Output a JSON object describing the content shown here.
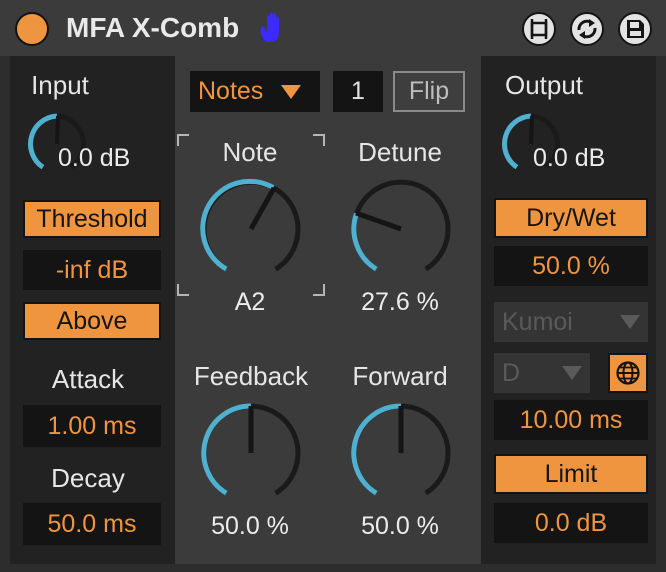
{
  "device": {
    "title": "MFA X-Comb",
    "hand_icon_color": "#3b2bff",
    "accent": "#f0953f",
    "knob_arc_color": "#4fb0d0"
  },
  "input": {
    "label": "Input",
    "value": "0.0 dB",
    "threshold_label": "Threshold",
    "threshold_value": "-inf dB",
    "mode_label": "Above",
    "attack_label": "Attack",
    "attack_value": "1.00 ms",
    "decay_label": "Decay",
    "decay_value": "50.0 ms"
  },
  "center": {
    "mode_select": "Notes",
    "count_value": "1",
    "flip_label": "Flip",
    "note_label": "Note",
    "note_value": "A2",
    "detune_label": "Detune",
    "detune_value": "27.6 %",
    "feedback_label": "Feedback",
    "feedback_value": "50.0 %",
    "forward_label": "Forward",
    "forward_value": "50.0 %"
  },
  "output": {
    "label": "Output",
    "value": "0.0 dB",
    "drywet_label": "Dry/Wet",
    "drywet_value": "50.0 %",
    "scale_select": "Kumoi",
    "key_select": "D",
    "time_value": "10.00 ms",
    "limit_label": "Limit",
    "limit_value": "0.0 dB"
  }
}
